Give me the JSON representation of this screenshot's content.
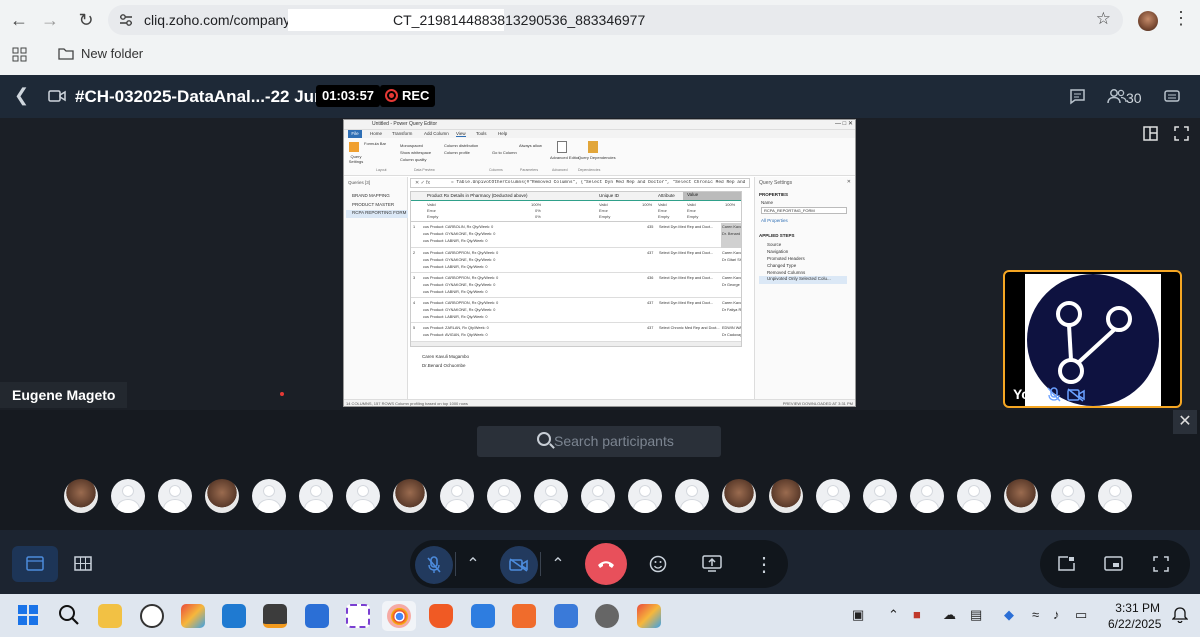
{
  "browser": {
    "url_prefix": "cliq.zoho.com/company,",
    "url_suffix": "CT_2198144883813290536_883346977",
    "bookmark_label": "New folder"
  },
  "meeting": {
    "title": "#CH-032025-DataAnal...-22 June",
    "timer": "01:03:57",
    "rec_label": "REC",
    "participant_count": "30",
    "presenter_name": "Eugene Mageto",
    "self_label": "You",
    "search_placeholder": "Search participants"
  },
  "shared_screen": {
    "window_title": "Untitled - Power Query Editor",
    "menu": [
      "File",
      "Home",
      "Transform",
      "Add Column",
      "View",
      "Tools",
      "Help"
    ],
    "ribbon": {
      "checks": [
        "Formula Bar",
        "Monospaced",
        "Show whitespace",
        "Column quality",
        "Column distribution",
        "Column profile",
        "Always allow"
      ],
      "buttons": [
        "Query Settings",
        "Go to Column",
        "Advanced Editor",
        "Query Dependencies"
      ],
      "groups": [
        "Layout",
        "Data Preview",
        "Columns",
        "Parameters",
        "Advanced",
        "Dependencies"
      ]
    },
    "formula": "= Table.UnpivotOtherColumns(#\"Removed Columns\", {\"Select Dyn Med Rep and Doctor\", \"Select Chronic Med Rep and",
    "queries_header": "Queries [3]",
    "queries": [
      "BRAND MAPPING",
      "PRODUCT MASTER",
      "RCPA REPORTING FORM"
    ],
    "columns": [
      "Product Rx Details in Pharmacy (Deducted above)",
      "Unique ID",
      "Attribute",
      "Value"
    ],
    "quality_labels": [
      "Valid",
      "Error",
      "Empty"
    ],
    "quality_values": [
      "100%",
      "0%",
      "0%"
    ],
    "rows": [
      {
        "num": "1",
        "product": [
          "cus Product: CARBOLIN, Rx Qty/Week: 0",
          "cus Product: GYNAKONE, Rx Qty/Week: 0",
          "cus Product: LABNIR, Rx Qty/Week: 0"
        ],
        "id": "435",
        "attr": "Select Dyn Med Rep and Doct...",
        "value": [
          "Caren Kavuli Mugambo",
          "Dr. Benard Ochuombe"
        ]
      },
      {
        "num": "2",
        "product": [
          "cus Product: CARBOPRON, Rx Qty/Week: 0",
          "cus Product: GYNAKONE, Rx Qty/Week: 0",
          "cus Product: LABNIR, Rx Qty/Week: 0"
        ],
        "id": "437",
        "attr": "Select Dyn Med Rep and Doct...",
        "value": [
          "Caren Kavuli Mugambo",
          "Dr Gitari Shah"
        ]
      },
      {
        "num": "3",
        "product": [
          "cus Product: CARBOPRON, Rx Qty/Week: 0",
          "cus Product: GYNAKONE, Rx Qty/Week: 0",
          "cus Product: LABNIR, Rx Qty/Week: 0"
        ],
        "id": "436",
        "attr": "Select Dyn Med Rep and Doct...",
        "value": [
          "Caren Kavuli Mugambo",
          "Dr George Moses"
        ]
      },
      {
        "num": "4",
        "product": [
          "cus Product: CARBOPRON, Rx Qty/Week: 0",
          "cus Product: GYNAKONE, Rx Qty/Week: 0",
          "cus Product: LABNIR, Rx Qty/Week: 0"
        ],
        "id": "437",
        "attr": "Select Dyn Med Rep and Doct...",
        "value": [
          "Caren Kavuli Mugambo",
          "Dr Fatiya R Mosaky"
        ]
      },
      {
        "num": "5",
        "product": [
          "cus Product: ZARLAN, Rx Qty/Week: 0",
          "cus Product: AVIGAN, Rx Qty/Week: 0"
        ],
        "id": "437",
        "attr": "Select Chronic Med Rep and Doct...",
        "value": [
          "EDWIN WAIRIMU",
          "Dr Cadoxay Maxwell"
        ]
      }
    ],
    "preview_lines": [
      "Caren Kavuli Mugambo",
      "Dr.Benard Ochuombe"
    ],
    "settings": {
      "title": "Query Settings",
      "properties": "PROPERTIES",
      "name_label": "Name",
      "name_value": "RCPA_REPORTING_FORM",
      "all_properties": "All Properties",
      "applied_steps": "APPLIED STEPS",
      "steps": [
        "Source",
        "Navigation",
        "Promoted Headers",
        "Changed Type",
        "Removed Columns",
        "Unpivoted Only Selected Colu..."
      ]
    },
    "status_left": "14 COLUMNS, 157 ROWS    Column profiling based on top 1000 rows",
    "status_right": "PREVIEW DOWNLOADED AT 3:31 PM"
  },
  "taskbar": {
    "time": "3:31 PM",
    "date": "6/22/2025"
  },
  "colors": {
    "accent_orange": "#f5a623",
    "hangup_red": "#e8505b",
    "rec_red": "#e53935",
    "zoho_logo_bg": "#0e1240"
  }
}
